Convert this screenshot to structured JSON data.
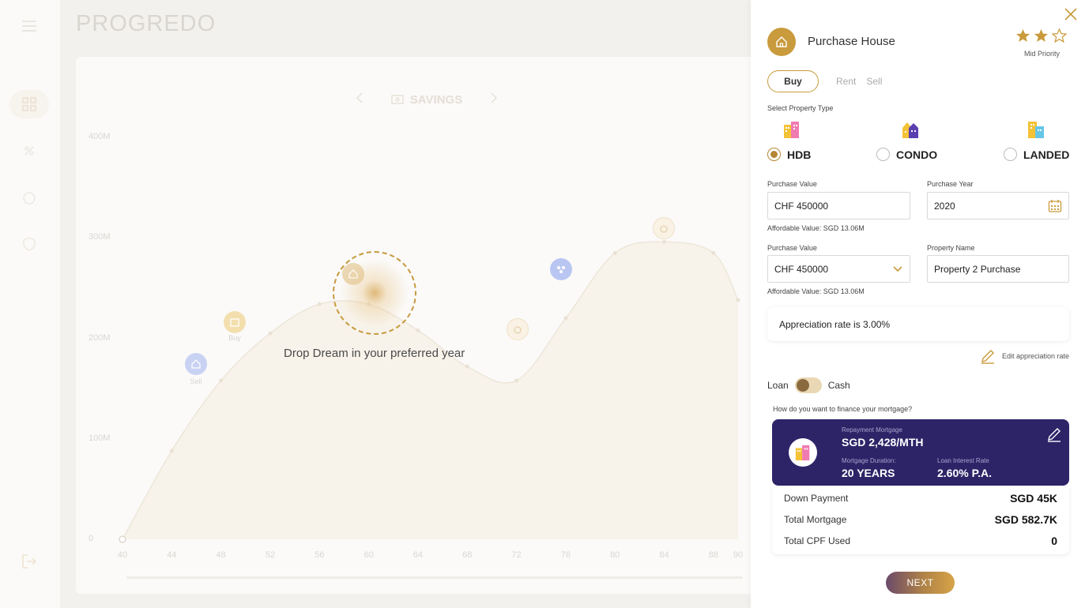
{
  "app": {
    "logo": "PROGREDO"
  },
  "chart_header": {
    "title": "SAVINGS"
  },
  "chart_data": {
    "type": "area",
    "title": "SAVINGS",
    "xlabel": "",
    "ylabel": "",
    "yticks": [
      "0",
      "100M",
      "200M",
      "300M",
      "400M"
    ],
    "xticks": [
      "40",
      "44",
      "48",
      "52",
      "56",
      "60",
      "64",
      "68",
      "72",
      "76",
      "80",
      "84",
      "88",
      "90"
    ],
    "x": [
      40,
      44,
      48,
      52,
      56,
      60,
      64,
      68,
      72,
      76,
      80,
      84,
      88,
      90
    ],
    "values": [
      0,
      88,
      158,
      205,
      234,
      234,
      208,
      172,
      158,
      220,
      285,
      296,
      285,
      238
    ],
    "ylim": [
      0,
      400
    ],
    "grid": false,
    "markers": [
      {
        "label": "Sell",
        "icon": "house-icon"
      },
      {
        "label": "Buy",
        "icon": "cart-icon"
      },
      {
        "label": "",
        "icon": "house-icon"
      },
      {
        "label": "",
        "icon": "ring-icon"
      },
      {
        "label": "",
        "icon": "family-icon"
      },
      {
        "label": "",
        "icon": "ring-icon"
      }
    ]
  },
  "drop_hint": "Drop Dream in your preferred year",
  "panel": {
    "title": "Purchase House",
    "priority": "Mid Priority",
    "stars_filled": 2,
    "stars_total": 3,
    "tabs": {
      "buy": "Buy",
      "rent": "Rent",
      "sell": "Sell"
    },
    "property_type_label": "Select Property Type",
    "property_types": [
      {
        "label": "HDB",
        "selected": true
      },
      {
        "label": "CONDO",
        "selected": false
      },
      {
        "label": "LANDED",
        "selected": false
      }
    ],
    "purchase_value_label": "Purchase Value",
    "purchase_value": "CHF 450000",
    "purchase_year_label": "Purchase Year",
    "purchase_year": "2020",
    "affordable_1": "Affordable Value: SGD 13.06M",
    "purchase_value_label_2": "Purchase Value",
    "purchase_value_2": "CHF 450000",
    "property_name_label": "Property Name",
    "property_name": "Property 2 Purchase",
    "affordable_2": "Affordable Value: SGD 13.06M",
    "appreciation": "Appreciation rate is 3.00%",
    "edit_appreciation": "Edit appreciation rate",
    "loan_label": "Loan",
    "cash_label": "Cash",
    "finance_question": "How do you want to finance your mortgage?",
    "mortgage": {
      "repayment_label": "Repayment Mortgage",
      "repayment_value": "SGD 2,428/MTH",
      "duration_label": "Mortgage Duration:",
      "duration_value": "20 YEARS",
      "rate_label": "Loan Interest Rate",
      "rate_value": "2.60% P.A."
    },
    "summary": [
      {
        "k": "Down Payment",
        "v": "SGD 45K"
      },
      {
        "k": "Total Mortgage",
        "v": "SGD 582.7K"
      },
      {
        "k": "Total CPF Used",
        "v": "0"
      }
    ],
    "next": "NEXT"
  },
  "colors": {
    "gold": "#c99b3c",
    "navy": "#2d2468"
  }
}
